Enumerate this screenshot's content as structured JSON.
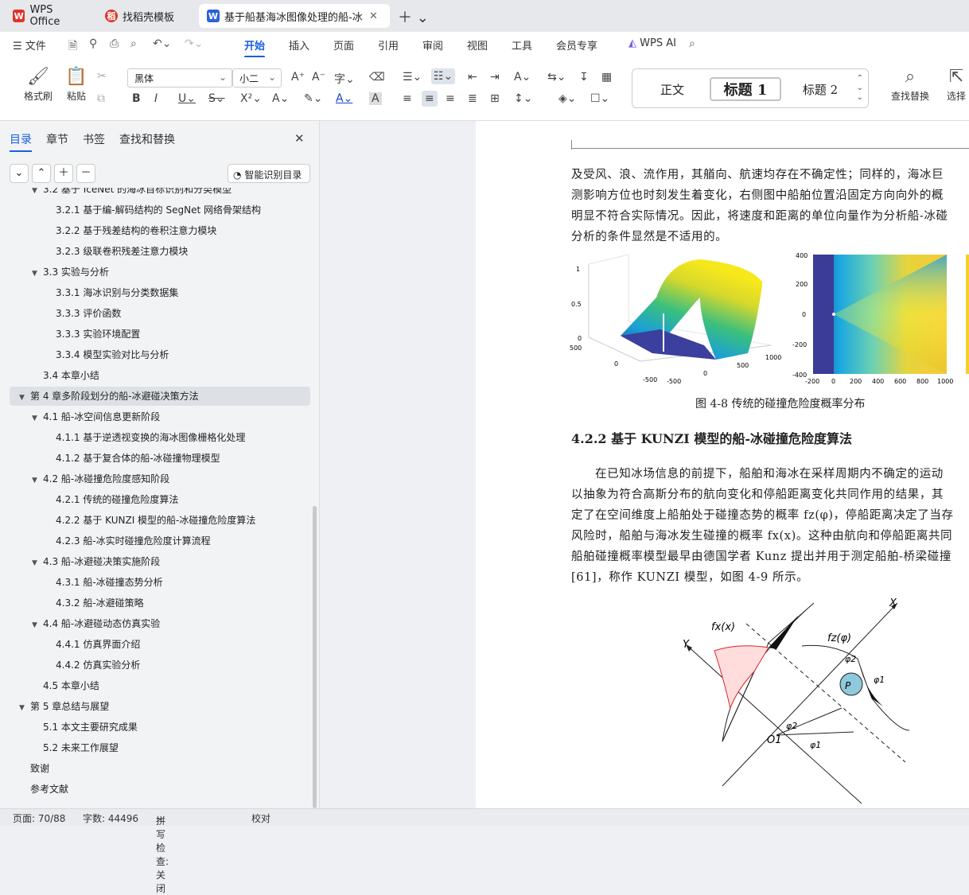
{
  "tabs": [
    {
      "label": "WPS Office",
      "icon": "wps-logo-icon"
    },
    {
      "label": "找稻壳模板",
      "icon": "daoke-icon"
    },
    {
      "label": "基于船基海冰图像处理的船-冰",
      "icon": "word-doc-icon"
    }
  ],
  "menu": {
    "file": "文件",
    "items": [
      "开始",
      "插入",
      "页面",
      "引用",
      "审阅",
      "视图",
      "工具",
      "会员专享"
    ],
    "ai": "WPS AI"
  },
  "ribbon": {
    "format_painter": "格式刷",
    "paste": "粘贴",
    "font_name": "黑体",
    "font_size": "小二",
    "styles": [
      "正文",
      "标题  1",
      "标题  2"
    ],
    "find_replace": "查找替换",
    "select": "选择"
  },
  "sidebar": {
    "tabs": [
      "目录",
      "章节",
      "书签",
      "查找和替换"
    ],
    "smart_button": "智能识别目录",
    "toc": [
      {
        "text": "3.2  基于 IceNet 的海冰目标识别和分类模型",
        "level": 2,
        "caret": true
      },
      {
        "text": "3.2.1  基于编-解码结构的 SegNet 网络骨架结构",
        "level": 3
      },
      {
        "text": "3.2.2  基于残差结构的卷积注意力模块",
        "level": 3
      },
      {
        "text": "3.2.3  级联卷积残差注意力模块",
        "level": 3
      },
      {
        "text": "3.3  实验与分析",
        "level": 2,
        "caret": true
      },
      {
        "text": "3.3.1  海冰识别与分类数据集",
        "level": 3
      },
      {
        "text": "3.3.3  评价函数",
        "level": 3
      },
      {
        "text": "3.3.3  实验环境配置",
        "level": 3
      },
      {
        "text": "3.3.4  模型实验对比与分析",
        "level": 3
      },
      {
        "text": "3.4  本章小结",
        "level": 2
      },
      {
        "text": "第 4 章多阶段划分的船-冰避碰决策方法",
        "level": 1,
        "caret": true,
        "highlight": true
      },
      {
        "text": "4.1  船-冰空间信息更新阶段",
        "level": 2,
        "caret": true
      },
      {
        "text": "4.1.1  基于逆透视变换的海冰图像栅格化处理",
        "level": 3
      },
      {
        "text": "4.1.2  基于复合体的船-冰碰撞物理模型",
        "level": 3
      },
      {
        "text": "4.2  船-冰碰撞危险度感知阶段",
        "level": 2,
        "caret": true
      },
      {
        "text": "4.2.1  传统的碰撞危险度算法",
        "level": 3
      },
      {
        "text": "4.2.2  基于 KUNZI 模型的船-冰碰撞危险度算法",
        "level": 3
      },
      {
        "text": "4.2.3  船-冰实时碰撞危险度计算流程",
        "level": 3
      },
      {
        "text": "4.3  船-冰避碰决策实施阶段",
        "level": 2,
        "caret": true
      },
      {
        "text": "4.3.1  船-冰碰撞态势分析",
        "level": 3
      },
      {
        "text": "4.3.2  船-冰避碰策略",
        "level": 3
      },
      {
        "text": "4.4  船-冰避碰动态仿真实验",
        "level": 2,
        "caret": true
      },
      {
        "text": "4.4.1  仿真界面介绍",
        "level": 3
      },
      {
        "text": "4.4.2  仿真实验分析",
        "level": 3
      },
      {
        "text": "4.5  本章小结",
        "level": 2
      },
      {
        "text": "第 5 章总结与展望",
        "level": 1,
        "caret": true
      },
      {
        "text": "5.1  本文主要研究成果",
        "level": 2
      },
      {
        "text": "5.2  未来工作展望",
        "level": 2
      },
      {
        "text": "致谢",
        "level": 1
      },
      {
        "text": "参考文献",
        "level": 1
      }
    ]
  },
  "document": {
    "para1": [
      "及受风、浪、流作用，其艏向、航速均存在不确定性；同样的，海冰巨",
      "测影响方位也时刻发生着变化，右侧图中船舶位置沿固定方向向外的概",
      "明显不符合实际情况。因此，将速度和距离的单位向量作为分析船-冰碰",
      "分析的条件显然是不适用的。"
    ],
    "fig_caption": "图 4-8  传统的碰撞危险度概率分布",
    "section": "4.2.2  基于 KUNZI 模型的船-冰碰撞危险度算法",
    "para2": [
      "在已知冰场信息的前提下，船舶和海冰在采样周期内不确定的运动",
      "以抽象为符合高斯分布的航向变化和停船距离变化共同作用的结果，其",
      "定了在空间维度上船舶处于碰撞态势的概率 fz(φ)，停船距离决定了当存",
      "风险时，船舶与海冰发生碰撞的概率 fx(x)。这种由航向和停船距离共同",
      "船舶碰撞概率模型最早由德国学者 Kunz 提出并用于测定船舶-桥梁碰撞",
      "[61]，称作 KUNZI 模型，如图 4-9 所示。"
    ],
    "plot3d": {
      "z_ticks": [
        "1",
        "0.5",
        "0"
      ],
      "y_ticks": [
        "500",
        "0",
        "-500"
      ],
      "x_ticks": [
        "-500",
        "0",
        "500",
        "1000"
      ]
    },
    "heatmap": {
      "y_ticks": [
        "400",
        "200",
        "0",
        "-200",
        "-400"
      ],
      "x_ticks": [
        "-200",
        "0",
        "200",
        "400",
        "600",
        "800",
        "1000"
      ]
    },
    "diagram": {
      "labels": [
        "X",
        "Y",
        "O1",
        "P",
        "φ1",
        "φ2",
        "φ1",
        "φ2",
        "fx(x)",
        "fz(φ)"
      ]
    }
  },
  "status": {
    "page": "页面: 70/88",
    "words": "字数: 44496",
    "spell": "拼写检查: 关闭",
    "proof": "校对"
  },
  "colors": {
    "accent": "#1a5fdc",
    "wps_red": "#e0342a",
    "word_blue": "#2b62d6"
  }
}
